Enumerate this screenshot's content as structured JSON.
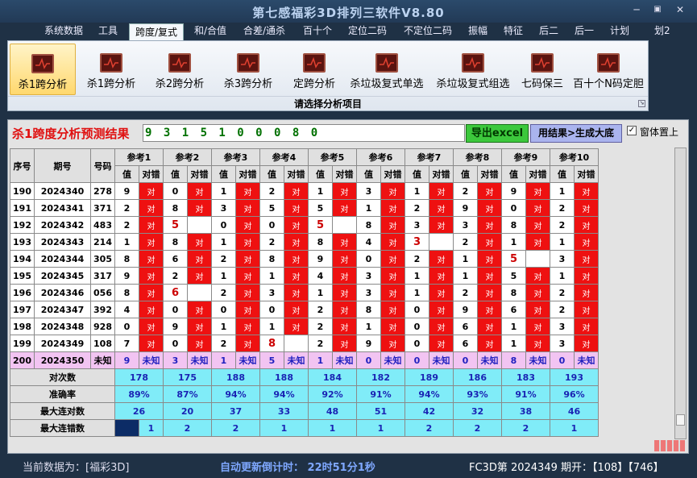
{
  "window": {
    "title": "第七感福彩3D排列三软件V8.80",
    "min": "─",
    "max": "▣",
    "close": "✕"
  },
  "menu": [
    "系统数据",
    "工具",
    "跨度/复式",
    "和/合值",
    "合差/通杀",
    "百十个",
    "定位二码",
    "不定位二码",
    "振幅",
    "特征",
    "后二",
    "后一",
    "计划",
    "划2"
  ],
  "ribbon": {
    "buttons": [
      "杀1跨分析",
      "杀1跨分析",
      "杀2跨分析",
      "杀3跨分析",
      "定跨分析",
      "杀垃圾复式单选",
      "杀垃圾复式组选",
      "七码保三",
      "百十个N码定胆"
    ],
    "footer": "请选择分析项目"
  },
  "result": {
    "label": "杀1跨度分析预测结果",
    "value": "9 3 1 5 1 0 0 0 8 0"
  },
  "buttons": {
    "excel": "导出excel",
    "generate": "用结果>生成大底",
    "pin": "窗体置上",
    "pin_check": "✓"
  },
  "table": {
    "h_seq": "序号",
    "h_period": "期号",
    "h_num": "号码",
    "refs": [
      "参考1",
      "参考2",
      "参考3",
      "参考4",
      "参考5",
      "参考6",
      "参考7",
      "参考8",
      "参考9",
      "参考10"
    ],
    "sub_val": "值",
    "sub_ok": "对错",
    "rows": [
      {
        "seq": "190",
        "period": "2024340",
        "num": "278",
        "vals": [
          "9",
          "0",
          "1",
          "2",
          "1",
          "3",
          "1",
          "2",
          "9",
          "1"
        ],
        "ok": [
          "对",
          "对",
          "对",
          "对",
          "对",
          "对",
          "对",
          "对",
          "对",
          "对"
        ]
      },
      {
        "seq": "191",
        "period": "2024341",
        "num": "371",
        "vals": [
          "2",
          "8",
          "3",
          "5",
          "5",
          "1",
          "2",
          "9",
          "0",
          "2"
        ],
        "ok": [
          "对",
          "对",
          "对",
          "对",
          "对",
          "对",
          "对",
          "对",
          "对",
          "对"
        ]
      },
      {
        "seq": "192",
        "period": "2024342",
        "num": "483",
        "vals": [
          "2",
          "5",
          "0",
          "0",
          "5",
          "8",
          "3",
          "3",
          "8",
          "2"
        ],
        "ok": [
          "对",
          "",
          "对",
          "对",
          "",
          "对",
          "对",
          "对",
          "对",
          "对"
        ]
      },
      {
        "seq": "193",
        "period": "2024343",
        "num": "214",
        "vals": [
          "1",
          "8",
          "1",
          "2",
          "8",
          "4",
          "3",
          "2",
          "1",
          "1"
        ],
        "ok": [
          "对",
          "对",
          "对",
          "对",
          "对",
          "对",
          "",
          "对",
          "对",
          "对"
        ]
      },
      {
        "seq": "194",
        "period": "2024344",
        "num": "305",
        "vals": [
          "8",
          "6",
          "2",
          "8",
          "9",
          "0",
          "2",
          "1",
          "5",
          "3"
        ],
        "ok": [
          "对",
          "对",
          "对",
          "对",
          "对",
          "对",
          "对",
          "对",
          "",
          "对"
        ]
      },
      {
        "seq": "195",
        "period": "2024345",
        "num": "317",
        "vals": [
          "9",
          "2",
          "1",
          "1",
          "4",
          "3",
          "1",
          "1",
          "5",
          "1"
        ],
        "ok": [
          "对",
          "对",
          "对",
          "对",
          "对",
          "对",
          "对",
          "对",
          "对",
          "对"
        ]
      },
      {
        "seq": "196",
        "period": "2024346",
        "num": "056",
        "vals": [
          "8",
          "6",
          "2",
          "3",
          "1",
          "3",
          "1",
          "2",
          "8",
          "2"
        ],
        "ok": [
          "对",
          "",
          "对",
          "对",
          "对",
          "对",
          "对",
          "对",
          "对",
          "对"
        ]
      },
      {
        "seq": "197",
        "period": "2024347",
        "num": "392",
        "vals": [
          "4",
          "0",
          "0",
          "0",
          "2",
          "8",
          "0",
          "9",
          "6",
          "2"
        ],
        "ok": [
          "对",
          "对",
          "对",
          "对",
          "对",
          "对",
          "对",
          "对",
          "对",
          "对"
        ]
      },
      {
        "seq": "198",
        "period": "2024348",
        "num": "928",
        "vals": [
          "0",
          "9",
          "1",
          "1",
          "2",
          "1",
          "0",
          "6",
          "1",
          "3"
        ],
        "ok": [
          "对",
          "对",
          "对",
          "对",
          "对",
          "对",
          "对",
          "对",
          "对",
          "对"
        ]
      },
      {
        "seq": "199",
        "period": "2024349",
        "num": "108",
        "vals": [
          "7",
          "0",
          "2",
          "8",
          "2",
          "9",
          "0",
          "6",
          "1",
          "3"
        ],
        "ok": [
          "对",
          "对",
          "对",
          "",
          "对",
          "对",
          "对",
          "对",
          "对",
          "对"
        ]
      },
      {
        "seq": "200",
        "period": "2024350",
        "num": "未知",
        "vals": [
          "9",
          "3",
          "1",
          "5",
          "1",
          "0",
          "0",
          "0",
          "8",
          "0"
        ],
        "ok": [
          "未知",
          "未知",
          "未知",
          "未知",
          "未知",
          "未知",
          "未知",
          "未知",
          "未知",
          "未知"
        ]
      }
    ],
    "stats": [
      {
        "label": "对次数",
        "vals": [
          "178",
          "175",
          "188",
          "188",
          "184",
          "182",
          "189",
          "186",
          "183",
          "193"
        ]
      },
      {
        "label": "准确率",
        "vals": [
          "89%",
          "87%",
          "94%",
          "94%",
          "92%",
          "91%",
          "94%",
          "93%",
          "91%",
          "96%"
        ]
      },
      {
        "label": "最大连对数",
        "vals": [
          "26",
          "20",
          "37",
          "33",
          "48",
          "51",
          "42",
          "32",
          "38",
          "46"
        ]
      },
      {
        "label": "最大连错数",
        "vals": [
          "1",
          "2",
          "2",
          "1",
          "1",
          "1",
          "2",
          "2",
          "2",
          "1"
        ]
      }
    ]
  },
  "status": {
    "current": "当前数据为：[福彩3D]",
    "countdown": "自动更新倒计时：  22时51分1秒",
    "period": "FC3D第 2024349 期开：【108】【746】"
  },
  "colors": {
    "hit": "#ee1111",
    "pending": "#f2c4f2",
    "stat": "#80ecf8",
    "background": "#1f3145"
  }
}
